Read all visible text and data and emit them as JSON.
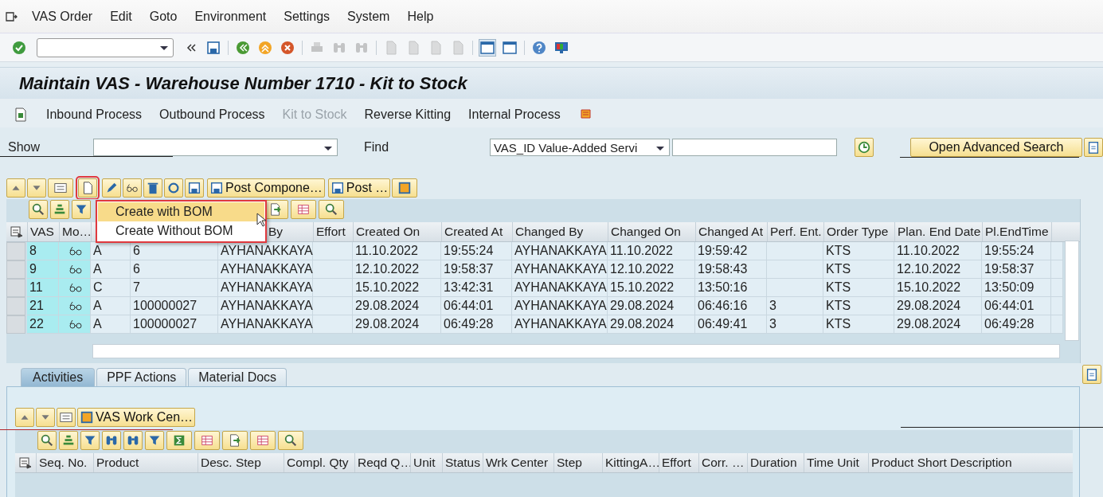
{
  "menu_bar": {
    "items": [
      "VAS Order",
      "Edit",
      "Goto",
      "Environment",
      "Settings",
      "System",
      "Help"
    ]
  },
  "system_toolbar": {
    "icons": [
      {
        "disabled": false
      },
      {
        "disabled": false
      },
      {
        "disabled": false
      },
      {
        "disabled": false
      },
      {
        "disabled": false
      },
      {
        "disabled": true
      },
      {
        "disabled": true
      },
      {
        "disabled": true
      },
      {
        "disabled": true
      },
      {
        "disabled": true
      },
      {
        "disabled": true
      },
      {
        "disabled": true
      },
      {
        "disabled": false
      },
      {
        "disabled": false
      },
      {
        "disabled": false
      },
      {
        "disabled": false
      }
    ]
  },
  "title": "Maintain VAS - Warehouse Number 1710 - Kit to Stock",
  "app_toolbar": {
    "items": [
      {
        "label": "Inbound Process",
        "disabled": false
      },
      {
        "label": "Outbound Process",
        "disabled": false
      },
      {
        "label": "Kit to Stock",
        "disabled": true
      },
      {
        "label": "Reverse Kitting",
        "disabled": false
      },
      {
        "label": "Internal Process",
        "disabled": false
      }
    ]
  },
  "filter": {
    "show_label": "Show",
    "find_label": "Find",
    "find_value": "VAS_ID Value-Added Servi",
    "advanced_search": "Open Advanced Search"
  },
  "grid_toolbar": {
    "buttons": [
      {
        "label": "Post Compone…"
      },
      {
        "label": "Post …"
      }
    ]
  },
  "create_menu": {
    "items": [
      {
        "label": "Create with BOM",
        "selected": true
      },
      {
        "label": "Create Without BOM",
        "selected": false
      }
    ]
  },
  "table": {
    "columns": [
      {
        "label": "VAS"
      },
      {
        "label": "Mo…"
      },
      {},
      {},
      {
        "label": "By"
      },
      {
        "label": "Effort"
      },
      {
        "label": "Created On"
      },
      {
        "label": "Created At"
      },
      {
        "label": "Changed By"
      },
      {
        "label": "Changed On"
      },
      {
        "label": "Changed At"
      },
      {
        "label": "Perf. Ent."
      },
      {
        "label": "Order Type"
      },
      {
        "label": "Plan. End Date"
      },
      {
        "label": "Pl.EndTime"
      }
    ],
    "rows": [
      {
        "vas": "8",
        "col_3": "A",
        "col_4": "6",
        "col_5": "AYHANAKKAYA",
        "created_on": "11.10.2022",
        "created_at": "19:55:24",
        "changed_by": "AYHANAKKAYA",
        "changed_on": "11.10.2022",
        "changed_at": "19:59:42",
        "order_type": "KTS",
        "plan_end_date": "11.10.2022",
        "pl_end_time": "19:55:24"
      },
      {
        "vas": "9",
        "col_3": "A",
        "col_4": "6",
        "col_5": "AYHANAKKAYA",
        "created_on": "12.10.2022",
        "created_at": "19:58:37",
        "changed_by": "AYHANAKKAYA",
        "changed_on": "12.10.2022",
        "changed_at": "19:58:43",
        "order_type": "KTS",
        "plan_end_date": "12.10.2022",
        "pl_end_time": "19:58:37"
      },
      {
        "vas": "11",
        "col_3": "C",
        "col_4": "7",
        "col_5": "AYHANAKKAYA",
        "created_on": "15.10.2022",
        "created_at": "13:42:31",
        "changed_by": "AYHANAKKAYA",
        "changed_on": "15.10.2022",
        "changed_at": "13:50:16",
        "order_type": "KTS",
        "plan_end_date": "15.10.2022",
        "pl_end_time": "13:50:09"
      },
      {
        "vas": "21",
        "col_3": "A",
        "col_4": "100000027",
        "col_5": "AYHANAKKAYA",
        "created_on": "29.08.2024",
        "created_at": "06:44:01",
        "changed_by": "AYHANAKKAYA",
        "changed_on": "29.08.2024",
        "changed_at": "06:46:16",
        "perf_ent": "3",
        "order_type": "KTS",
        "plan_end_date": "29.08.2024",
        "pl_end_time": "06:44:01"
      },
      {
        "vas": "22",
        "col_3": "A",
        "col_4": "100000027",
        "col_5": "AYHANAKKAYA",
        "created_on": "29.08.2024",
        "created_at": "06:49:28",
        "changed_by": "AYHANAKKAYA",
        "changed_on": "29.08.2024",
        "changed_at": "06:49:41",
        "perf_ent": "3",
        "order_type": "KTS",
        "plan_end_date": "29.08.2024",
        "pl_end_time": "06:49:28"
      }
    ]
  },
  "tabs": [
    {
      "label": "Activities",
      "selected": true
    },
    {
      "label": "PPF Actions",
      "selected": false
    },
    {
      "label": "Material Docs",
      "selected": false
    }
  ],
  "activities": {
    "button": "VAS Work Cen…",
    "columns": [
      "Seq. No.",
      "Product",
      "Desc. Step",
      "Compl. Qty",
      "Reqd Q…",
      "Unit",
      "Status",
      "Wrk Center",
      "Step",
      "KittingA…",
      "Effort",
      "Corr. …",
      "Duration",
      "Time Unit",
      "Product Short Description"
    ]
  }
}
